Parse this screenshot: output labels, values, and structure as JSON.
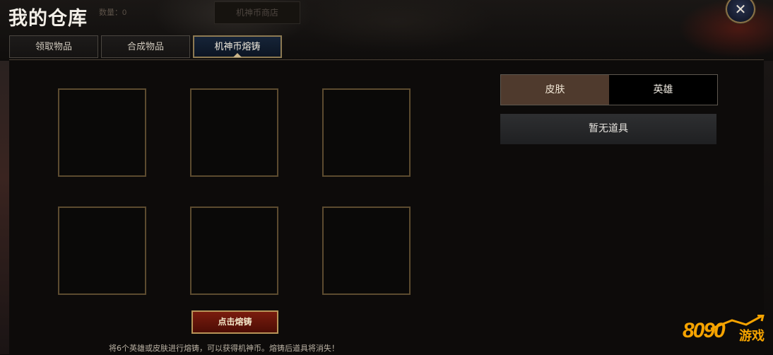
{
  "header": {
    "title": "我的仓库",
    "count_label": "数量：0",
    "shop_button": "机神币商店",
    "close_symbol": "✕"
  },
  "tabs": [
    {
      "label": "领取物品",
      "active": false
    },
    {
      "label": "合成物品",
      "active": false
    },
    {
      "label": "机神币熔铸",
      "active": true
    }
  ],
  "forge": {
    "slots": 6,
    "button_label": "点击熔铸",
    "hint": "将6个英雄或皮肤进行熔铸，可以获得机神币。熔铸后道具将消失！"
  },
  "filter": {
    "options": [
      "皮肤",
      "英雄"
    ],
    "selected": "皮肤"
  },
  "inventory": {
    "empty_text": "暂无道具"
  },
  "watermark": {
    "number": "8090",
    "text": "游戏"
  },
  "colors": {
    "accent_gold": "#8d7a52",
    "forge_red": "#7a1c0e",
    "skin_selected": "#4f3a2d",
    "watermark_orange": "#f5a300"
  }
}
